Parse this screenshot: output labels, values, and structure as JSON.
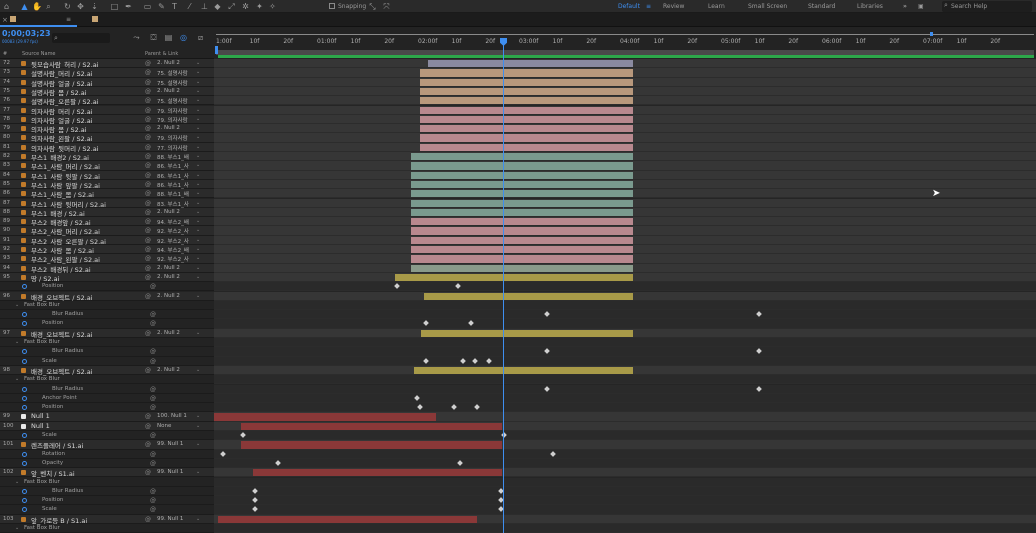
{
  "toolbar": {
    "snapping_label": "Snapping",
    "workspaces": [
      "Default",
      "Review",
      "Learn",
      "Small Screen",
      "Standard",
      "Libraries"
    ],
    "active_workspace": "Default",
    "search_placeholder": "Search Help"
  },
  "header": {
    "timecode": "0;00;03;23",
    "timecode_sub": "00083 (29.97 fps)",
    "search_icon": "search-icon"
  },
  "columns": {
    "source_name": "Source Name",
    "parent_link": "Parent & Link"
  },
  "ruler": {
    "labels": [
      "1:00f",
      "10f",
      "20f",
      "01:00f",
      "10f",
      "20f",
      "02:00f",
      "10f",
      "20f",
      "03:00f",
      "10f",
      "20f",
      "04:00f",
      "10f",
      "20f",
      "05:00f",
      "10f",
      "20f",
      "06:00f",
      "10f",
      "20f",
      "07:00f",
      "10f",
      "20f"
    ]
  },
  "layers": [
    {
      "num": "72",
      "name": "뒷모습사람_허리 / S2.ai",
      "parent": "2. Null 2",
      "type": "layer",
      "bar_color": "#8a8aa0",
      "bar_start": 0.26,
      "bar_end": 0.51
    },
    {
      "num": "73",
      "name": "설명사람_머리 / S2.ai",
      "parent": "75. 설명사람",
      "type": "layer",
      "bar_color": "#b8987c",
      "bar_start": 0.25,
      "bar_end": 0.51
    },
    {
      "num": "74",
      "name": "설명사람_얼굴 / S2.ai",
      "parent": "75. 설명사람",
      "type": "layer",
      "bar_color": "#b8987c",
      "bar_start": 0.25,
      "bar_end": 0.51
    },
    {
      "num": "75",
      "name": "설명사람_몸 / S2.ai",
      "parent": "2. Null 2",
      "type": "layer",
      "bar_color": "#b8987c",
      "bar_start": 0.25,
      "bar_end": 0.51
    },
    {
      "num": "76",
      "name": "설명사람_오른팔 / S2.ai",
      "parent": "75. 설명사람",
      "type": "layer",
      "bar_color": "#b8987c",
      "bar_start": 0.25,
      "bar_end": 0.51
    },
    {
      "num": "77",
      "name": "의자사람_머리 / S2.ai",
      "parent": "79. 의자사람",
      "type": "layer",
      "bar_color": "#b8888e",
      "bar_start": 0.25,
      "bar_end": 0.51
    },
    {
      "num": "78",
      "name": "의자사람_얼굴 / S2.ai",
      "parent": "79. 의자사람",
      "type": "layer",
      "bar_color": "#b8888e",
      "bar_start": 0.25,
      "bar_end": 0.51
    },
    {
      "num": "79",
      "name": "의자사람_몸 / S2.ai",
      "parent": "2. Null 2",
      "type": "layer",
      "bar_color": "#b8888e",
      "bar_start": 0.25,
      "bar_end": 0.51
    },
    {
      "num": "80",
      "name": "의자사람_왼팔 / S2.ai",
      "parent": "79. 의자사람",
      "type": "layer",
      "bar_color": "#b8888e",
      "bar_start": 0.25,
      "bar_end": 0.51
    },
    {
      "num": "81",
      "name": "의자사람_뒷머리 / S2.ai",
      "parent": "77. 의자사람",
      "type": "layer",
      "bar_color": "#b8888e",
      "bar_start": 0.25,
      "bar_end": 0.51
    },
    {
      "num": "82",
      "name": "부스1_배경2 / S2.ai",
      "parent": "88. 부스1_배",
      "type": "layer",
      "bar_color": "#7a9a8e",
      "bar_start": 0.24,
      "bar_end": 0.51
    },
    {
      "num": "83",
      "name": "부스1_사람_머리 / S2.ai",
      "parent": "86. 부스1_사",
      "type": "layer",
      "bar_color": "#7a9a8e",
      "bar_start": 0.24,
      "bar_end": 0.51
    },
    {
      "num": "84",
      "name": "부스1_사람_뒷팔 / S2.ai",
      "parent": "86. 부스1_사",
      "type": "layer",
      "bar_color": "#7a9a8e",
      "bar_start": 0.24,
      "bar_end": 0.51
    },
    {
      "num": "85",
      "name": "부스1_사람_앞팔 / S2.ai",
      "parent": "86. 부스1_사",
      "type": "layer",
      "bar_color": "#7a9a8e",
      "bar_start": 0.24,
      "bar_end": 0.51
    },
    {
      "num": "86",
      "name": "부스1_사람_몸 / S2.ai",
      "parent": "88. 부스1_배",
      "type": "layer",
      "bar_color": "#7a9a8e",
      "bar_start": 0.24,
      "bar_end": 0.51
    },
    {
      "num": "87",
      "name": "부스1_사람_뒷머리 / S2.ai",
      "parent": "83. 부스1_사",
      "type": "layer",
      "bar_color": "#7a9a8e",
      "bar_start": 0.24,
      "bar_end": 0.51
    },
    {
      "num": "88",
      "name": "부스1_배경 / S2.ai",
      "parent": "2. Null 2",
      "type": "layer",
      "bar_color": "#7a9a8e",
      "bar_start": 0.24,
      "bar_end": 0.51
    },
    {
      "num": "89",
      "name": "부스2_배경앞 / S2.ai",
      "parent": "94. 부스2_배",
      "type": "layer",
      "bar_color": "#b8888e",
      "bar_start": 0.24,
      "bar_end": 0.51
    },
    {
      "num": "90",
      "name": "부스2_사람_머리 / S2.ai",
      "parent": "92. 부스2_사",
      "type": "layer",
      "bar_color": "#b8888e",
      "bar_start": 0.24,
      "bar_end": 0.51
    },
    {
      "num": "91",
      "name": "부스2_사람_오른팔 / S2.ai",
      "parent": "92. 부스2_사",
      "type": "layer",
      "bar_color": "#b8888e",
      "bar_start": 0.24,
      "bar_end": 0.51
    },
    {
      "num": "92",
      "name": "부스2_사람_몸 / S2.ai",
      "parent": "94. 부스2_배",
      "type": "layer",
      "bar_color": "#b8888e",
      "bar_start": 0.24,
      "bar_end": 0.51
    },
    {
      "num": "93",
      "name": "부스2_사람_왼팔 / S2.ai",
      "parent": "92. 부스2_사",
      "type": "layer",
      "bar_color": "#b8888e",
      "bar_start": 0.24,
      "bar_end": 0.51
    },
    {
      "num": "94",
      "name": "부스2_배경뒤 / S2.ai",
      "parent": "2. Null 2",
      "type": "layer",
      "bar_color": "#8a9a8a",
      "bar_start": 0.24,
      "bar_end": 0.51
    },
    {
      "num": "95",
      "name": "땅 / S2.ai",
      "parent": "2. Null 2",
      "type": "layer",
      "bar_color": "#a89a48",
      "bar_start": 0.22,
      "bar_end": 0.51
    },
    {
      "num": "",
      "name": "Position",
      "parent": "",
      "type": "prop",
      "keyframes": [
        0.22,
        0.295
      ]
    },
    {
      "num": "96",
      "name": "배경_오브젝트 / S2.ai",
      "parent": "2. Null 2",
      "type": "layer",
      "bar_color": "#a89a48",
      "bar_start": 0.255,
      "bar_end": 0.51
    },
    {
      "num": "",
      "name": "Fast Box Blur",
      "parent": "",
      "type": "group"
    },
    {
      "num": "",
      "name": "Blur Radius",
      "parent": "",
      "type": "prop",
      "keyframes": [
        0.403,
        0.66
      ]
    },
    {
      "num": "",
      "name": "Position",
      "parent": "",
      "type": "prop",
      "keyframes": [
        0.255,
        0.31
      ]
    },
    {
      "num": "97",
      "name": "배경_오브젝트 / S2.ai",
      "parent": "2. Null 2",
      "type": "layer",
      "bar_color": "#a89a48",
      "bar_start": 0.252,
      "bar_end": 0.51
    },
    {
      "num": "",
      "name": "Fast Box Blur",
      "parent": "",
      "type": "group"
    },
    {
      "num": "",
      "name": "Blur Radius",
      "parent": "",
      "type": "prop",
      "keyframes": [
        0.403,
        0.66
      ]
    },
    {
      "num": "",
      "name": "Scale",
      "parent": "",
      "type": "prop",
      "keyframes": [
        0.255,
        0.3,
        0.315,
        0.332
      ]
    },
    {
      "num": "98",
      "name": "배경_오브젝트 / S2.ai",
      "parent": "2. Null 2",
      "type": "layer",
      "bar_color": "#a89a48",
      "bar_start": 0.243,
      "bar_end": 0.51
    },
    {
      "num": "",
      "name": "Fast Box Blur",
      "parent": "",
      "type": "group"
    },
    {
      "num": "",
      "name": "Blur Radius",
      "parent": "",
      "type": "prop",
      "keyframes": [
        0.403,
        0.66
      ]
    },
    {
      "num": "",
      "name": "Anchor Point",
      "parent": "",
      "type": "prop",
      "keyframes": [
        0.245
      ]
    },
    {
      "num": "",
      "name": "Position",
      "parent": "",
      "type": "prop",
      "keyframes": [
        0.248,
        0.29,
        0.318
      ]
    },
    {
      "num": "99",
      "name": "Null 1",
      "parent": "100. Null 1",
      "type": "layer",
      "null": true,
      "bar_color": "#8a3838",
      "bar_start": 0.0,
      "bar_end": 0.27
    },
    {
      "num": "100",
      "name": "Null 1",
      "parent": "None",
      "type": "layer",
      "null": true,
      "bar_color": "#8a3838",
      "bar_start": 0.033,
      "bar_end": 0.35
    },
    {
      "num": "",
      "name": "Scale",
      "parent": "",
      "type": "prop",
      "keyframes": [
        0.033,
        0.35
      ]
    },
    {
      "num": "101",
      "name": "렌즈플레어 / S1.ai",
      "parent": "99. Null 1",
      "type": "layer",
      "bar_color": "#8a3838",
      "bar_start": 0.033,
      "bar_end": 0.35
    },
    {
      "num": "",
      "name": "Rotation",
      "parent": "",
      "type": "prop",
      "keyframes": [
        0.008,
        0.41
      ]
    },
    {
      "num": "",
      "name": "Opacity",
      "parent": "",
      "type": "prop",
      "keyframes": [
        0.075,
        0.297
      ]
    },
    {
      "num": "102",
      "name": "앞_벤치 / S1.ai",
      "parent": "99. Null 1",
      "type": "layer",
      "bar_color": "#8a3838",
      "bar_start": 0.047,
      "bar_end": 0.35
    },
    {
      "num": "",
      "name": "Fast Box Blur",
      "parent": "",
      "type": "group"
    },
    {
      "num": "",
      "name": "Blur Radius",
      "parent": "",
      "type": "prop",
      "keyframes": [
        0.047,
        0.347
      ]
    },
    {
      "num": "",
      "name": "Position",
      "parent": "",
      "type": "prop",
      "keyframes": [
        0.047,
        0.347
      ]
    },
    {
      "num": "",
      "name": "Scale",
      "parent": "",
      "type": "prop",
      "keyframes": [
        0.047,
        0.347
      ]
    },
    {
      "num": "103",
      "name": "앞_가로등 B / S1.ai",
      "parent": "99. Null 1",
      "type": "layer",
      "bar_color": "#8a3838",
      "bar_start": 0.005,
      "bar_end": 0.32
    },
    {
      "num": "",
      "name": "Fast Box Blur",
      "parent": "",
      "type": "group"
    }
  ]
}
